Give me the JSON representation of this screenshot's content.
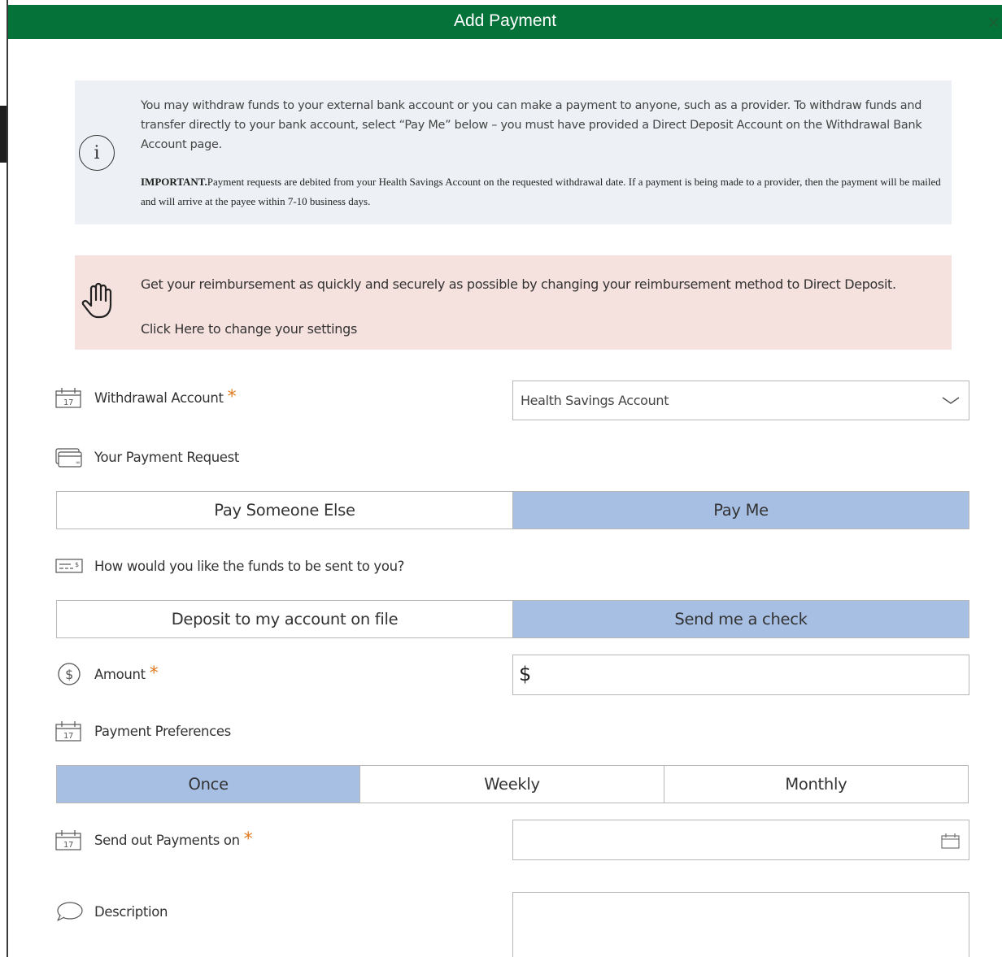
{
  "dialog": {
    "title": "Add Payment",
    "close_glyph": "×"
  },
  "info": {
    "icon": "info-icon",
    "text": "You may withdraw funds to your external bank account or you can make a payment to anyone, such as a provider. To withdraw funds and transfer directly to your bank account, select “Pay Me” below – you must have provided a Direct Deposit Account on the Withdrawal Bank Account page.",
    "important_label": "IMPORTANT.",
    "important_text": "Payment requests are debited from your Health Savings Account on the requested withdrawal date. If a payment is being made to a provider, then the payment will be mailed and will arrive at the payee within 7-10 business days."
  },
  "alert": {
    "icon": "hand-icon",
    "text": "Get your reimbursement as quickly and securely as possible by changing your reimbursement method to Direct Deposit.",
    "link": "Click Here to change your settings"
  },
  "withdrawal": {
    "label": "Withdrawal Account",
    "required": "*",
    "icon": "calendar-icon",
    "selected": "Health Savings Account"
  },
  "payment_request": {
    "label": "Your Payment Request",
    "icon": "card-icon",
    "options": [
      "Pay Someone Else",
      "Pay Me"
    ],
    "selected": "Pay Me"
  },
  "funds": {
    "label": "How would you like the funds to be sent to you?",
    "icon": "check-icon",
    "options": [
      "Deposit to my account on file",
      "Send me a check"
    ],
    "selected": "Send me a check"
  },
  "amount": {
    "label": "Amount",
    "required": "*",
    "icon": "dollar-icon",
    "currency": "$",
    "value": ""
  },
  "preferences": {
    "label": "Payment Preferences",
    "icon": "calendar-icon",
    "options": [
      "Once",
      "Weekly",
      "Monthly"
    ],
    "selected": "Once"
  },
  "send_date": {
    "label": "Send out Payments on",
    "required": "*",
    "icon": "calendar-icon",
    "value": ""
  },
  "description": {
    "label": "Description",
    "icon": "comment-icon",
    "value": ""
  },
  "colors": {
    "header": "#047239",
    "selected_option": "#a7bfe3",
    "info_bg": "#edf0f4",
    "alert_bg": "#f5e1dd",
    "required": "#e07a1f"
  }
}
